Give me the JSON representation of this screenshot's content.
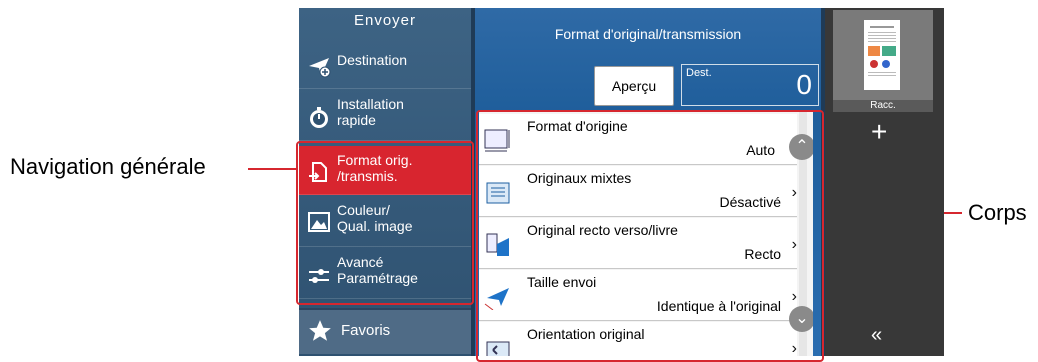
{
  "callouts": {
    "left": "Navigation générale",
    "right": "Corps"
  },
  "nav": {
    "title": "Envoyer",
    "items": [
      {
        "label_1": "Destination",
        "label_2": "",
        "icon": "destination-icon"
      },
      {
        "label_1": "Installation",
        "label_2": "rapide",
        "icon": "stopwatch-icon"
      },
      {
        "label_1": "Format orig.",
        "label_2": "/transmis.",
        "icon": "document-format-icon"
      },
      {
        "label_1": "Couleur/",
        "label_2": "Qual. image",
        "icon": "image-quality-icon"
      },
      {
        "label_1": "Avancé",
        "label_2": "Paramétrage",
        "icon": "advanced-settings-icon"
      }
    ],
    "favorites": "Favoris"
  },
  "main": {
    "title": "Format d'original/transmission",
    "preview": "Aperçu",
    "dest_label": "Dest.",
    "dest_count": "0",
    "rows": [
      {
        "label": "Format d'origine",
        "value": "Auto"
      },
      {
        "label": "Originaux mixtes",
        "value": "Désactivé"
      },
      {
        "label": "Original recto verso/livre",
        "value": "Recto"
      },
      {
        "label": "Taille envoi",
        "value": "Identique à l'original"
      },
      {
        "label": "Orientation original",
        "value": ""
      }
    ]
  },
  "right_panel": {
    "shortcut_label": "Racc.",
    "add_symbol": "+",
    "collapse_symbol": "«"
  },
  "colors": {
    "highlight": "#d6272f",
    "nav_active": "#d8252f"
  }
}
